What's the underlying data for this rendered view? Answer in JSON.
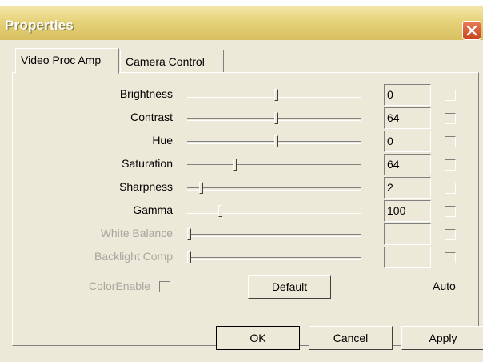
{
  "window": {
    "title": "Properties"
  },
  "tabs": [
    {
      "label": "Video Proc Amp"
    },
    {
      "label": "Camera Control"
    }
  ],
  "controls": [
    {
      "label": "Brightness",
      "value": "0",
      "level": 0.5,
      "enabled": true
    },
    {
      "label": "Contrast",
      "value": "64",
      "level": 0.5,
      "enabled": true
    },
    {
      "label": "Hue",
      "value": "0",
      "level": 0.5,
      "enabled": true
    },
    {
      "label": "Saturation",
      "value": "64",
      "level": 0.26,
      "enabled": true
    },
    {
      "label": "Sharpness",
      "value": "2",
      "level": 0.07,
      "enabled": true
    },
    {
      "label": "Gamma",
      "value": "100",
      "level": 0.18,
      "enabled": true
    },
    {
      "label": "White Balance",
      "value": "",
      "level": 0.0,
      "enabled": false
    },
    {
      "label": "Backlight Comp",
      "value": "",
      "level": 0.0,
      "enabled": false
    }
  ],
  "color_enable": {
    "label": "ColorEnable",
    "checked": false
  },
  "default_button": "Default",
  "auto_label": "Auto",
  "buttons": {
    "ok": "OK",
    "cancel": "Cancel",
    "apply": "Apply"
  },
  "colors": {
    "title_bar": "#e6d27a",
    "dialog_bg": "#ece9d8",
    "close_button": "#d4532e",
    "disabled_text": "#a7a7a0"
  }
}
